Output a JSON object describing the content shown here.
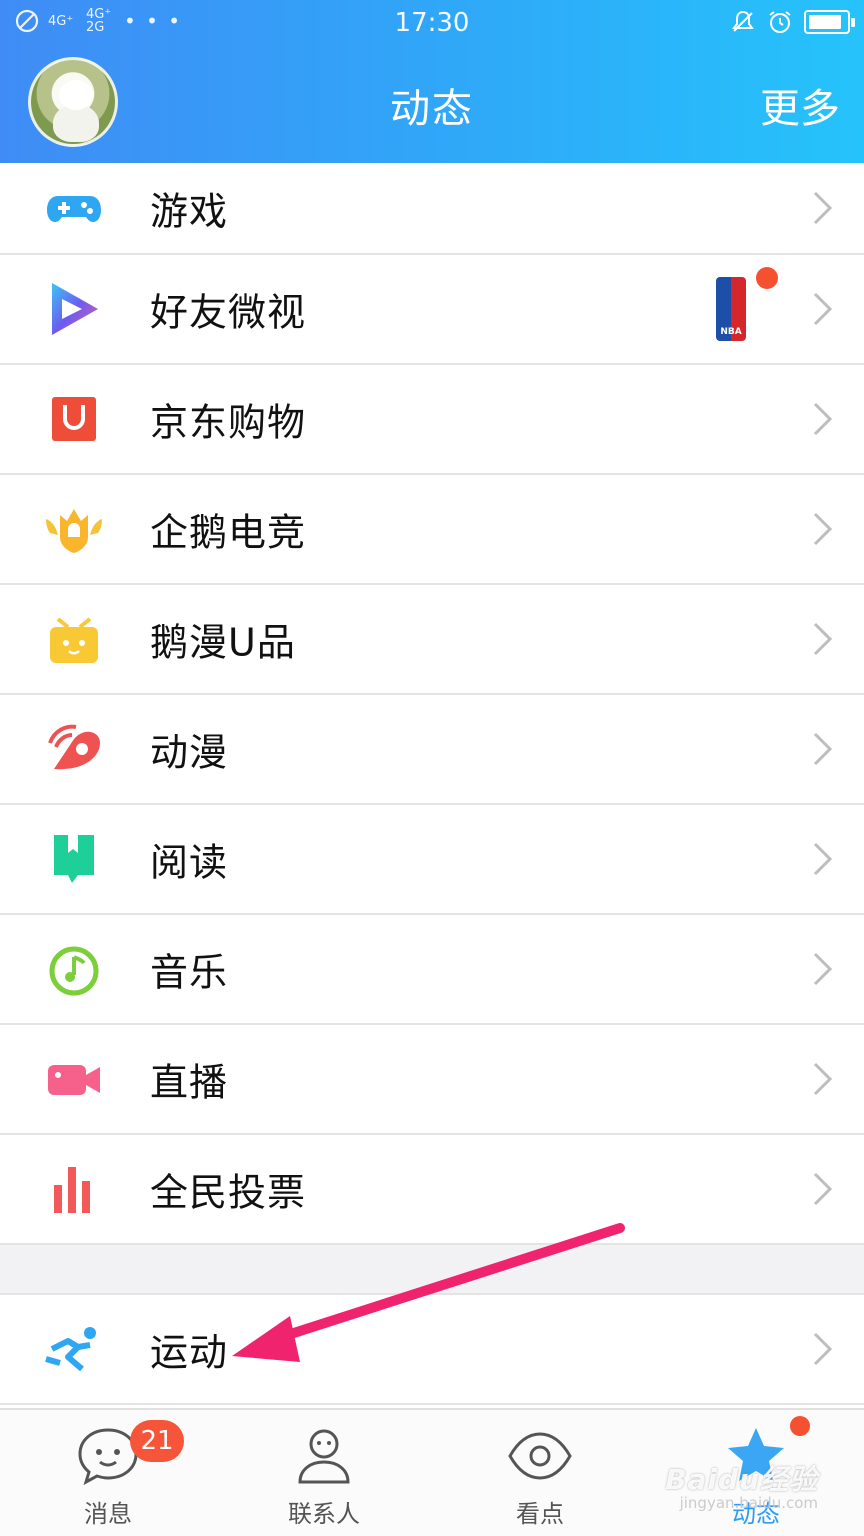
{
  "status_bar": {
    "signal_1": "4G⁺",
    "signal_2": "4G⁺ 2G",
    "more_dots": "• • •",
    "time": "17:30",
    "battery_level": 0.9
  },
  "header": {
    "title": "动态",
    "more_label": "更多"
  },
  "menu": {
    "items": [
      {
        "label": "游戏",
        "icon": "gamepad-icon",
        "color": "#2fa6f2"
      },
      {
        "label": "好友微视",
        "icon": "weishi-play-icon",
        "color": "#6b5cf2"
      },
      {
        "label": "京东购物",
        "icon": "jd-bag-icon",
        "color": "#ee4d3a"
      },
      {
        "label": "企鹅电竞",
        "icon": "crown-shield-icon",
        "color": "#f5c23a"
      },
      {
        "label": "鹅漫U品",
        "icon": "gift-box-icon",
        "color": "#f9c835"
      },
      {
        "label": "动漫",
        "icon": "anime-fan-icon",
        "color": "#f05252"
      },
      {
        "label": "阅读",
        "icon": "bookmark-book-icon",
        "color": "#1fcf9a"
      },
      {
        "label": "音乐",
        "icon": "music-note-icon",
        "color": "#7ccf3a"
      },
      {
        "label": "直播",
        "icon": "video-camera-icon",
        "color": "#f5618b"
      },
      {
        "label": "全民投票",
        "icon": "bar-chart-icon",
        "color": "#f25a5a"
      }
    ],
    "sport": {
      "label": "运动",
      "icon": "running-icon",
      "color": "#2fa6f2"
    },
    "promo_badge": "NBA"
  },
  "tabbar": {
    "tabs": [
      {
        "label": "消息",
        "icon": "chat-bubble-icon",
        "badge": "21"
      },
      {
        "label": "联系人",
        "icon": "contact-person-icon"
      },
      {
        "label": "看点",
        "icon": "eye-icon"
      },
      {
        "label": "动态",
        "icon": "star-icon",
        "active": true
      }
    ]
  },
  "watermark": {
    "brand": "Baidu经验",
    "url": "jingyan.baidu.com"
  }
}
